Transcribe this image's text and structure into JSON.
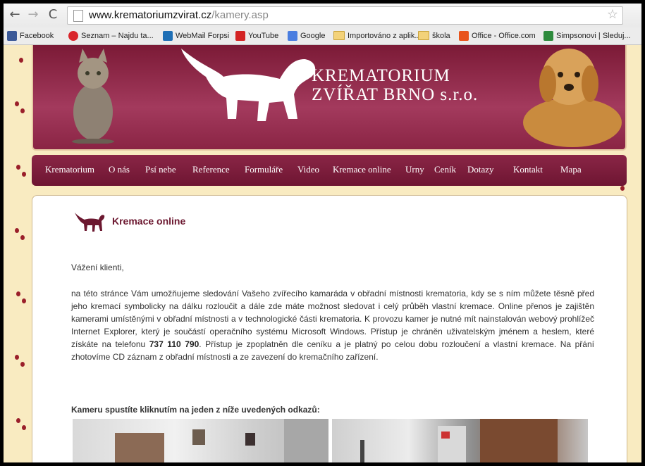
{
  "browser": {
    "url_domain": "www.krematoriumzvirat.cz",
    "url_path": "/kamery.asp",
    "bookmarks": [
      {
        "label": "Facebook",
        "icon": "facebook-icon",
        "color": "#3b5998"
      },
      {
        "label": "Seznam – Najdu ta...",
        "icon": "seznam-icon",
        "color": "#d9262c"
      },
      {
        "label": "WebMail Forpsi",
        "icon": "webmail-icon",
        "color": "#1f6fb5"
      },
      {
        "label": "YouTube",
        "icon": "youtube-icon",
        "color": "#d32323"
      },
      {
        "label": "Google",
        "icon": "google-icon",
        "color": "#4a7ee0"
      },
      {
        "label": "Importováno z aplik...",
        "icon": "folder-icon",
        "color": "#f3d27a"
      },
      {
        "label": "škola",
        "icon": "folder-icon",
        "color": "#f3d27a"
      },
      {
        "label": "Office - Office.com",
        "icon": "office-icon",
        "color": "#e8531b"
      },
      {
        "label": "Simpsonovi | Sleduj...",
        "icon": "simpsons-icon",
        "color": "#2e8b3d"
      }
    ]
  },
  "header": {
    "company_line1": "KREMATORIUM",
    "company_line2": "ZVÍŘAT BRNO s.r.o."
  },
  "menu": [
    "Krematorium",
    "O nás",
    "Psí nebe",
    "Reference",
    "Formuláře",
    "Video",
    "Kremace online",
    "Urny",
    "Ceník",
    "Dotazy",
    "Kontakt",
    "Mapa"
  ],
  "content": {
    "title": "Kremace online",
    "greeting": "Vážení klienti,",
    "para_before_phone": "na této stránce Vám umožňujeme sledování Vašeho zvířecího kamaráda v obřadní místnosti krematoria, kdy se s ním můžete těsně před jeho kremací symbolicky na dálku rozloučit a dále zde máte možnost sledovat i celý průběh vlastní kremace. Online přenos je zajištěn kamerami umístěnými v obřadní místnosti a v technologické části krematoria. K provozu kamer je nutné mít nainstalován webový prohlížeč Internet Explorer, který je součástí operačního systému Microsoft Windows. Přístup je chráněn uživatelským jménem a heslem, které získáte na telefonu ",
    "phone": "737 110 790",
    "para_after_phone": ". Přístup je zpoplatněn dle ceníku a je platný po celou dobu rozloučení a vlastní kremace. Na přání zhotovíme CD záznam z obřadní místnosti a ze zavezení do kremačního zařízení.",
    "camera_heading": "Kameru spustíte kliknutím na jeden z níže uvedených odkazů:"
  }
}
